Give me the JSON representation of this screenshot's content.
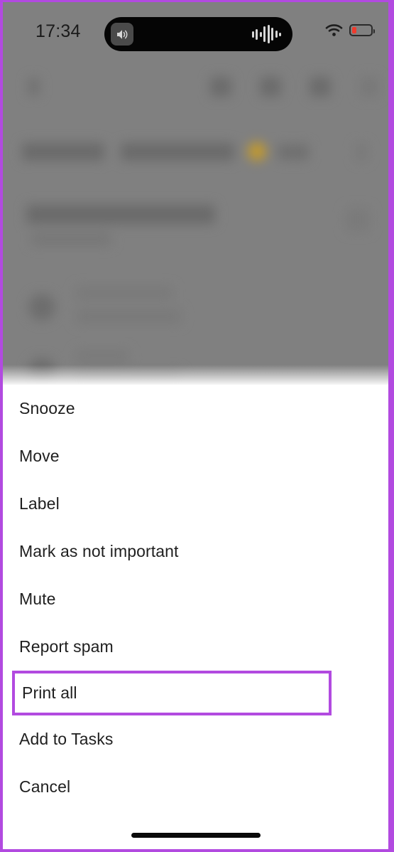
{
  "status_bar": {
    "time": "17:34",
    "speaker_icon": "speaker-volume-icon",
    "waveform_icon": "audio-waveform-icon",
    "wifi_icon": "wifi-icon",
    "battery_icon": "battery-low-icon",
    "battery_level_percent": 22,
    "battery_color": "#f03b2d"
  },
  "background": {
    "app": "gmail-thread-view",
    "state": "blurred",
    "back_icon": "back-arrow-icon",
    "toolbar_icons": [
      "archive-icon",
      "delete-icon",
      "mark-unread-icon",
      "more-options-icon"
    ],
    "star_icon": "star-icon",
    "star_color": "#c49a2b",
    "backdrop_color": "#808080"
  },
  "action_sheet": {
    "items": [
      {
        "label": "Snooze",
        "name": "menu-item-snooze",
        "highlighted": false
      },
      {
        "label": "Move",
        "name": "menu-item-move",
        "highlighted": false
      },
      {
        "label": "Label",
        "name": "menu-item-label",
        "highlighted": false
      },
      {
        "label": "Mark as not important",
        "name": "menu-item-mark-not-important",
        "highlighted": false
      },
      {
        "label": "Mute",
        "name": "menu-item-mute",
        "highlighted": false
      },
      {
        "label": "Report spam",
        "name": "menu-item-report-spam",
        "highlighted": false
      },
      {
        "label": "Print all",
        "name": "menu-item-print-all",
        "highlighted": true
      },
      {
        "label": "Add to Tasks",
        "name": "menu-item-add-to-tasks",
        "highlighted": false
      },
      {
        "label": "Cancel",
        "name": "menu-item-cancel",
        "highlighted": false
      }
    ]
  },
  "annotation": {
    "highlight_color": "#b24ae0",
    "frame_color": "#b24ae0",
    "highlighted_label": "Print all"
  },
  "home_indicator": {
    "name": "home-indicator"
  }
}
